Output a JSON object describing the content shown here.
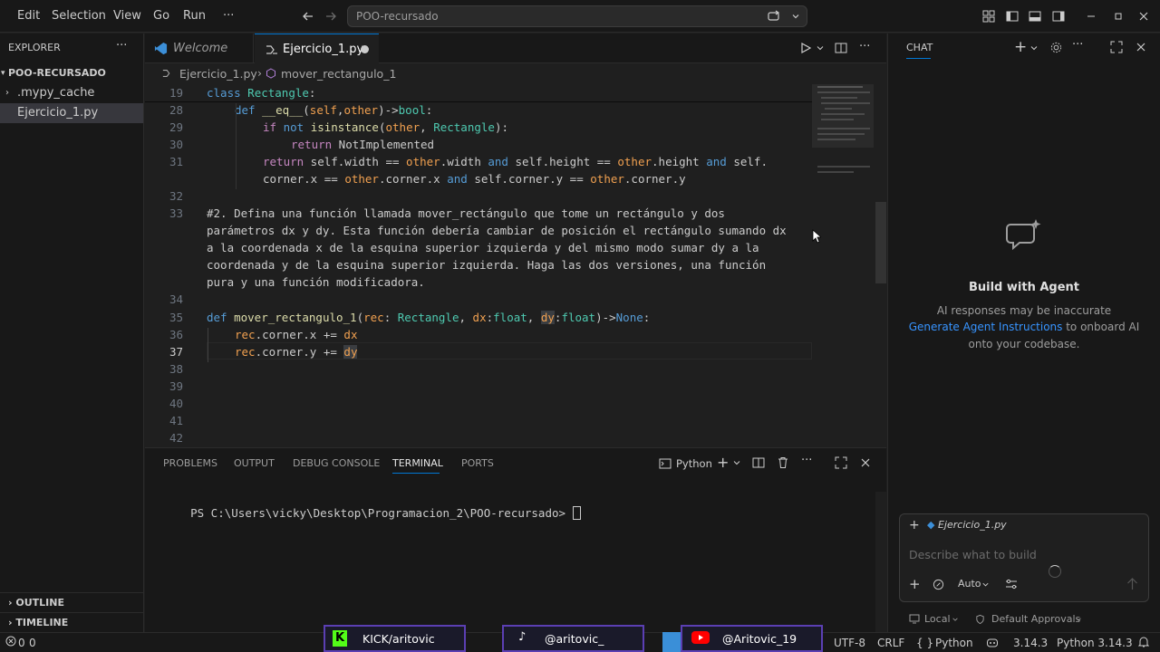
{
  "menu": [
    "Edit",
    "Selection",
    "View",
    "Go",
    "Run",
    "···"
  ],
  "command_center": "POO-recursado",
  "explorer": {
    "title": "EXPLORER",
    "folder": "POO-RECURSADO",
    "items": [
      ".mypy_cache",
      "Ejercicio_1.py"
    ],
    "outline": "OUTLINE",
    "timeline": "TIMELINE"
  },
  "tabs": [
    {
      "label": "Welcome"
    },
    {
      "label": "Ejercicio_1.py"
    }
  ],
  "breadcrumb": {
    "file": "Ejercicio_1.py",
    "symbol": "mover_rectangulo_1"
  },
  "code": {
    "line_numbers": [
      "19",
      "28",
      "29",
      "30",
      "31",
      "32",
      "33",
      "34",
      "35",
      "36",
      "37",
      "38",
      "39",
      "40",
      "41",
      "42"
    ],
    "comment_lines": [
      "#2. Defina una función llamada mover_rectángulo que tome un rectángulo y dos",
      "parámetros dx y dy. Esta función debería cambiar de posición el rectángulo sumando dx",
      "a la coordenada x de la esquina superior izquierda y del mismo modo sumar dy a la",
      "coordenada y de la esquina superior izquierda. Haga las dos versiones, una función",
      "pura y una función modificadora."
    ]
  },
  "panel": {
    "tabs": [
      "PROBLEMS",
      "OUTPUT",
      "DEBUG CONSOLE",
      "TERMINAL",
      "PORTS"
    ],
    "active_tab": "TERMINAL",
    "shell": "Python",
    "prompt": "PS C:\\Users\\vicky\\Desktop\\Programacion_2\\POO-recursado> "
  },
  "chat": {
    "title": "CHAT",
    "heading": "Build with Agent",
    "line1": "AI responses may be inaccurate",
    "link": "Generate Agent Instructions",
    "line2_rest": " to onboard AI",
    "line3": "onto your codebase.",
    "context_file": "Ejercicio_1.py",
    "input_placeholder": "Describe what to build",
    "mode": "Auto",
    "location": "Local",
    "approvals": "Default Approvals"
  },
  "status": {
    "problems": "0",
    "warnings": "0",
    "encoding": "UTF-8",
    "eol": "CRLF",
    "language": "Python",
    "version": "3.14.3",
    "interpreter": "Python 3.14.3"
  },
  "overlays": {
    "kick": "KICK/aritovic",
    "tiktok": "@aritovic_",
    "youtube": "@Aritovic_19"
  },
  "colors": {
    "accent": "#0078d4",
    "keyword": "#569cd6",
    "function": "#dcdcaa",
    "class": "#4ec9b0",
    "parameter": "#f0a050",
    "overlay_border": "#5b3fb3"
  }
}
